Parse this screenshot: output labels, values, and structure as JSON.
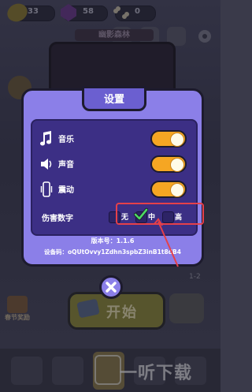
{
  "resources": {
    "gold": "33",
    "gems": "58",
    "bones": "0"
  },
  "banner": "幽影森林",
  "festival_label": "春节奖励",
  "start_label": "开始",
  "side_level": "1-2",
  "watermark": "一听下载",
  "settings": {
    "title": "设置",
    "music_label": "音乐",
    "sound_label": "声音",
    "vibration_label": "震动",
    "damage_label": "伤害数字",
    "damage_options": [
      "无",
      "中",
      "高"
    ],
    "damage_selected": "中",
    "music_on": true,
    "sound_on": true,
    "vibration_on": true,
    "version_text": "版本号：1.1.6",
    "device_text": "设备码：oQUtOvvy1Zdhn3spbZ3inB1t8dB4"
  },
  "colors": {
    "dialog": "#8b7fe8",
    "inner": "#3c2f85",
    "toggle": "#f5a623",
    "highlight": "#e5404a"
  }
}
